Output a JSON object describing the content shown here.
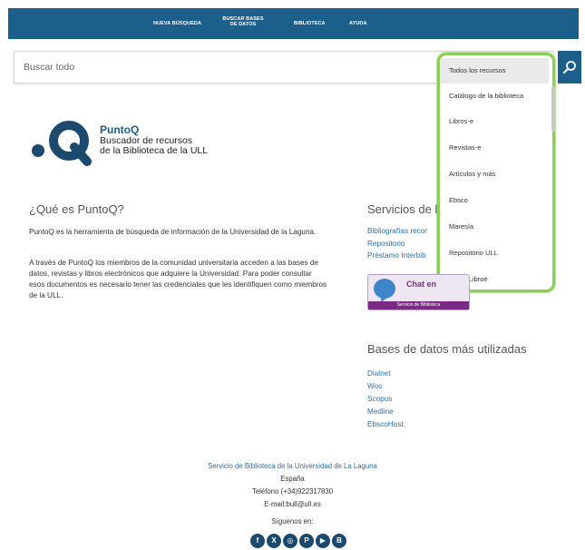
{
  "nav": {
    "items": [
      {
        "label": "NUEVA BÚSQUEDA"
      },
      {
        "label": "BUSCAR BASES DE DATOS"
      },
      {
        "label": "BIBLIOTECA"
      },
      {
        "label": "AYUDA"
      }
    ]
  },
  "search": {
    "placeholder": "Buscar todo",
    "button_icon": "search-icon"
  },
  "dropdown": {
    "selected": "Todos los recursos",
    "options": [
      "Todos los recursos",
      "Catálogo de la biblioteca",
      "Libros-e",
      "Revistas-e",
      "Artículos y más",
      "Ebsco",
      "Maresía",
      "Repositorio ULL",
      "Portal Libroé"
    ]
  },
  "logo": {
    "title": "PuntoQ",
    "subtitle_line1": "Buscador de recursos",
    "subtitle_line2": "de la Biblioteca de la ULL"
  },
  "about": {
    "heading": "¿Qué es PuntoQ?",
    "paragraph1": "PuntoQ es la herramienta de búsqueda de información de la Universidad de la Laguna.",
    "paragraph2": "A través de PuntoQ los miembros de la comunidad universitaria acceden a las bases de datos, revistas y libros electrónicos que adquiere la Universidad. Para poder consultar esos documentos es necesario tener las credenciales que les identifiquen como miembros de la ULL."
  },
  "services": {
    "heading": "Servicios de l",
    "links": [
      "Bibliografías recor",
      "Repositorio",
      "Préstamo Interbib"
    ],
    "chat_label": "Chat en",
    "chat_bar": "Servicio de Biblioteca"
  },
  "databases": {
    "heading": "Bases de datos más utilizadas",
    "items": [
      "Dialnet",
      "Wos",
      "Scopus",
      "Medline",
      "EbscoHost"
    ]
  },
  "footer": {
    "org": "Servicio de Biblioteca de la Universidad de La Laguna",
    "country": "España",
    "phone": "Teléfono (+34)922317830",
    "email": "E-mail:bull@ull.es",
    "follow": "Síguenos en:",
    "social_icons": [
      "facebook-icon",
      "x-twitter-icon",
      "instagram-icon",
      "pinterest-icon",
      "youtube-icon",
      "blog-icon"
    ]
  },
  "colors": {
    "nav_bg": "#1b5f8a",
    "dropdown_border": "#8ccf57",
    "link": "#2a6fa8",
    "chat_purple": "#7b2b86"
  }
}
